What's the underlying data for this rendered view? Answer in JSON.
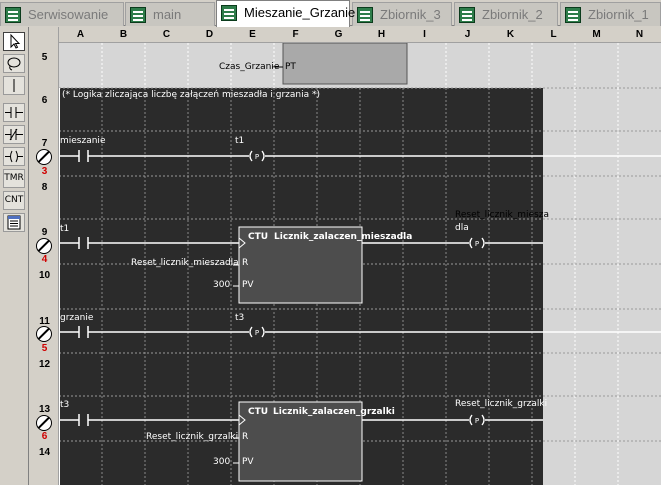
{
  "tabs": [
    {
      "label": "Serwisowanie",
      "active": false
    },
    {
      "label": "main",
      "active": false
    },
    {
      "label": "Mieszanie_Grzanie",
      "active": true
    },
    {
      "label": "Zbiornik_3",
      "active": false
    },
    {
      "label": "Zbiornik_2",
      "active": false
    },
    {
      "label": "Zbiornik_1",
      "active": false
    }
  ],
  "toolbox": {
    "select": "select-arrow-icon",
    "lasso": "lasso-icon",
    "wire": "vertical-wire-icon",
    "no_contact": "normally-open-contact-icon",
    "nc_contact": "normally-closed-contact-icon",
    "coil": "coil-icon",
    "tmr_label": "TMR",
    "cnt_label": "CNT",
    "table": "variable-table-icon"
  },
  "columns": [
    "A",
    "B",
    "C",
    "D",
    "E",
    "F",
    "G",
    "H",
    "I",
    "J",
    "K",
    "L",
    "M",
    "N"
  ],
  "rows": [
    "5",
    "6",
    "7",
    "8",
    "9",
    "10",
    "11",
    "12",
    "13",
    "14"
  ],
  "rungs": [
    "3",
    "4",
    "5",
    "6"
  ],
  "ladder": {
    "timer_input_label": "Czas_Grzanie",
    "timer_pin": "PT",
    "comment": "(* Logika zliczająca liczbę załączeń mieszadła i grzania *)",
    "rung3": {
      "contact": "mieszanie",
      "coil": "t1"
    },
    "rung4": {
      "contact": "t1",
      "block_type": "CTU",
      "block_name": "Licznik_zalaczen_mieszadla",
      "reset_var": "Reset_licznik_mieszadla",
      "pin_r": "R",
      "pv_value": "300",
      "pin_pv": "PV",
      "coil_line1": "Reset_licznik_miesza",
      "coil_line2": "dla"
    },
    "rung5": {
      "contact": "grzanie",
      "coil": "t3"
    },
    "rung6": {
      "contact": "t3",
      "block_type": "CTU",
      "block_name": "Licznik_zalaczen_grzalki",
      "reset_var": "Reset_licznik_grzalki",
      "pin_r": "R",
      "pv_value": "300",
      "pin_pv": "PV",
      "coil": "Reset_licznik_grzalki"
    },
    "coil_symbol": "(P)"
  }
}
